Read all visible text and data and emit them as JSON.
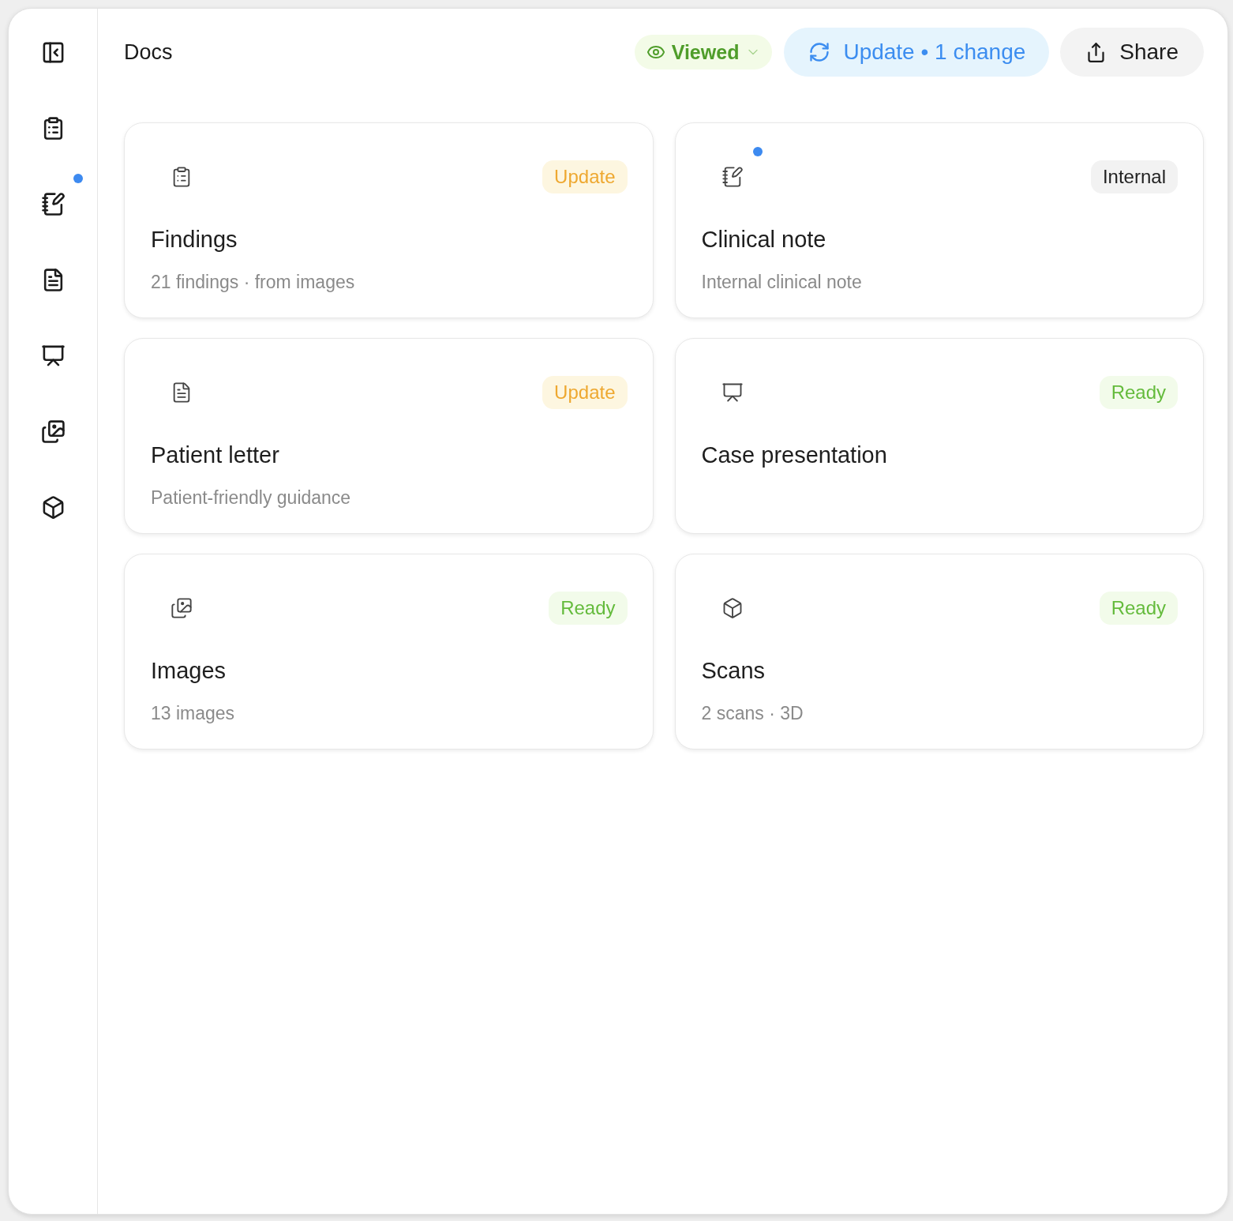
{
  "sidebar": {
    "items": [
      {
        "kind": "collapse",
        "unread": false
      },
      {
        "kind": "clipboard",
        "unread": false
      },
      {
        "kind": "notebook",
        "unread": true
      },
      {
        "kind": "document",
        "unread": false
      },
      {
        "kind": "presentation",
        "unread": false
      },
      {
        "kind": "images",
        "unread": false
      },
      {
        "kind": "cube",
        "unread": false
      }
    ]
  },
  "header": {
    "title": "Docs",
    "viewed": {
      "label": "Viewed"
    },
    "update": {
      "label": "Update • 1 change"
    },
    "share": {
      "label": "Share"
    }
  },
  "cards": [
    {
      "kind": "clipboard",
      "title": "Findings",
      "subtitle": "21 findings · from images",
      "badge": {
        "label": "Update",
        "kind": "update"
      },
      "unread": false
    },
    {
      "kind": "notebook",
      "title": "Clinical note",
      "subtitle": "Internal clinical note",
      "badge": {
        "label": "Internal",
        "kind": "internal"
      },
      "unread": true
    },
    {
      "kind": "document",
      "title": "Patient letter",
      "subtitle": "Patient-friendly guidance",
      "badge": {
        "label": "Update",
        "kind": "update"
      },
      "unread": false
    },
    {
      "kind": "presentation",
      "title": "Case presentation",
      "badge": {
        "label": "Ready",
        "kind": "ready"
      },
      "unread": false
    },
    {
      "kind": "images",
      "title": "Images",
      "subtitle": "13 images",
      "badge": {
        "label": "Ready",
        "kind": "ready"
      },
      "unread": false
    },
    {
      "kind": "cube",
      "title": "Scans",
      "subtitle": "2 scans · 3D",
      "badge": {
        "label": "Ready",
        "kind": "ready"
      },
      "unread": false
    }
  ]
}
